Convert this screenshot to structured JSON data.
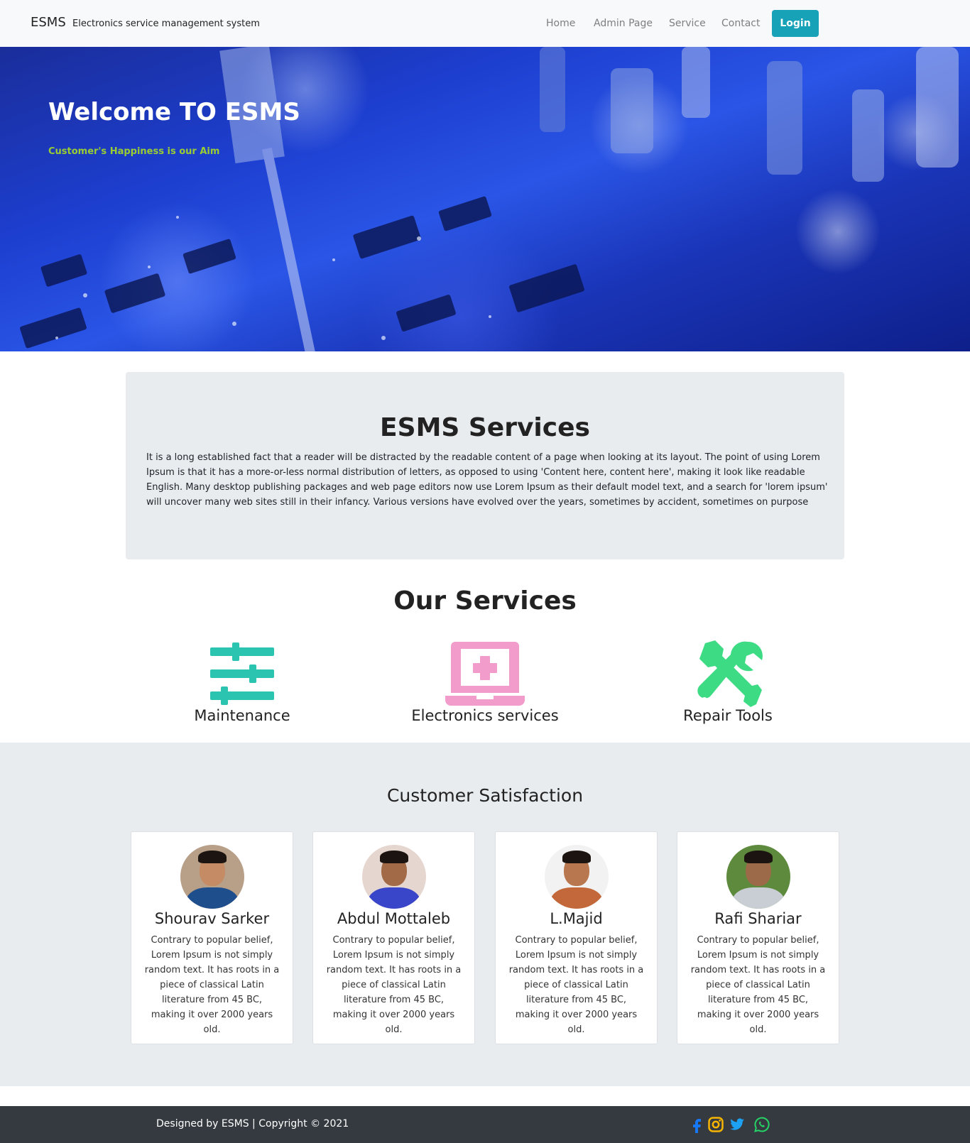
{
  "navbar": {
    "brand": "ESMS",
    "subtitle": "Electronics service management system",
    "links": [
      {
        "label": "Home"
      },
      {
        "label": "Admin Page"
      },
      {
        "label": "Service"
      },
      {
        "label": "Contact"
      }
    ],
    "login_label": "Login",
    "login_color": "#17a2b8"
  },
  "hero": {
    "title": "Welcome TO ESMS",
    "subtitle": "Customer's Happiness is our Aim"
  },
  "about": {
    "title": "ESMS Services",
    "text": "It is a long established fact that a reader will be distracted by the readable content of a page when looking at its layout. The point of using Lorem Ipsum is that it has a more-or-less normal distribution of letters, as opposed to using 'Content here, content here', making it look like readable English. Many desktop publishing packages and web page editors now use Lorem Ipsum as their default model text, and a search for 'lorem ipsum' will uncover many web sites still in their infancy. Various versions have evolved over the years, sometimes by accident, sometimes on purpose"
  },
  "services": {
    "title": "Our Services",
    "items": [
      {
        "label": "Maintenance",
        "icon": "sliders-icon",
        "color": "#2bc4b0"
      },
      {
        "label": "Electronics services",
        "icon": "laptop-medical-icon",
        "color": "#f29ccb"
      },
      {
        "label": "Repair Tools",
        "icon": "tools-icon",
        "color": "#3ddc84"
      }
    ]
  },
  "satisfaction": {
    "title": "Customer Satisfaction",
    "cards": [
      {
        "name": "Shourav Sarker",
        "text": "Contrary to popular belief, Lorem Ipsum is not simply random text. It has roots in a piece of classical Latin literature from 45 BC, making it over 2000 years old."
      },
      {
        "name": "Abdul Mottaleb",
        "text": "Contrary to popular belief, Lorem Ipsum is not simply random text. It has roots in a piece of classical Latin literature from 45 BC, making it over 2000 years old."
      },
      {
        "name": "L.Majid",
        "text": "Contrary to popular belief, Lorem Ipsum is not simply random text. It has roots in a piece of classical Latin literature from 45 BC, making it over 2000 years old."
      },
      {
        "name": "Rafi Shariar",
        "text": "Contrary to popular belief, Lorem Ipsum is not simply random text. It has roots in a piece of classical Latin literature from 45 BC, making it over 2000 years old."
      }
    ]
  },
  "footer": {
    "text": "Designed by ESMS | Copyright © 2021",
    "social": [
      {
        "icon": "facebook-icon",
        "color": "#1877f2"
      },
      {
        "icon": "instagram-icon",
        "color": "#f5b400"
      },
      {
        "icon": "twitter-icon",
        "color": "#1da1f2"
      },
      {
        "icon": "whatsapp-icon",
        "color": "#25d366"
      }
    ]
  }
}
